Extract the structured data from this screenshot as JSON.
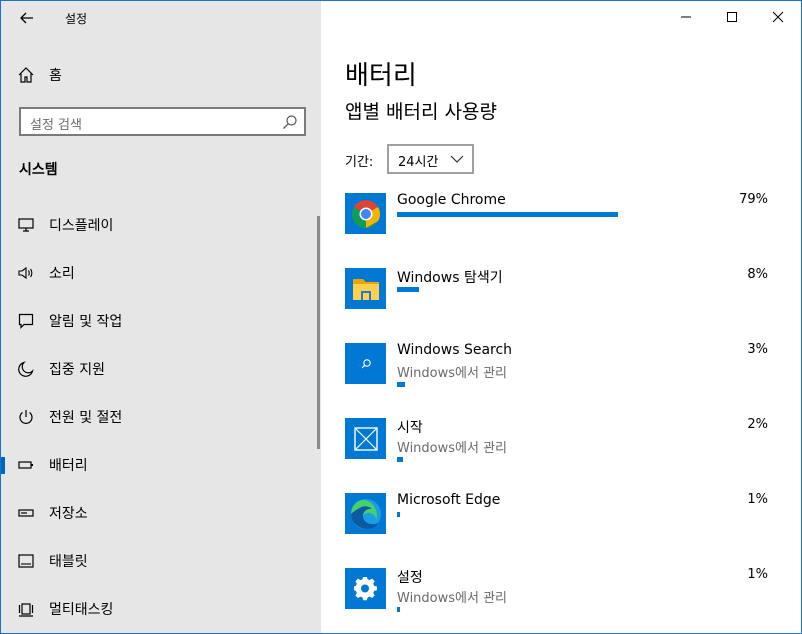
{
  "window": {
    "title": "설정",
    "controls": [
      "minimize-icon",
      "maximize-icon",
      "close-icon"
    ]
  },
  "sidebar": {
    "home_label": "홈",
    "search_placeholder": "설정 검색",
    "section_title": "시스템",
    "items": [
      {
        "label": "디스플레이",
        "icon": "monitor-icon",
        "selected": false
      },
      {
        "label": "소리",
        "icon": "speaker-icon",
        "selected": false
      },
      {
        "label": "알림 및 작업",
        "icon": "notification-icon",
        "selected": false
      },
      {
        "label": "집중 지원",
        "icon": "moon-icon",
        "selected": false
      },
      {
        "label": "전원 및 절전",
        "icon": "power-icon",
        "selected": false
      },
      {
        "label": "배터리",
        "icon": "battery-icon",
        "selected": true
      },
      {
        "label": "저장소",
        "icon": "storage-icon",
        "selected": false
      },
      {
        "label": "태블릿",
        "icon": "tablet-icon",
        "selected": false
      },
      {
        "label": "멀티태스킹",
        "icon": "multitasking-icon",
        "selected": false
      }
    ]
  },
  "main": {
    "title": "배터리",
    "subtitle": "앱별 배터리 사용량",
    "period_label": "기간:",
    "period_value": "24시간",
    "apps": [
      {
        "name": "Google Chrome",
        "manage": "",
        "percent_text": "79%",
        "usage": 0.79,
        "icon": "chrome-icon"
      },
      {
        "name": "Windows 탐색기",
        "manage": "",
        "percent_text": "8%",
        "usage": 0.08,
        "icon": "folder-icon"
      },
      {
        "name": "Windows Search",
        "manage": "Windows에서 관리",
        "percent_text": "3%",
        "usage": 0.03,
        "icon": "search-app-icon"
      },
      {
        "name": "시작",
        "manage": "Windows에서 관리",
        "percent_text": "2%",
        "usage": 0.02,
        "icon": "start-icon"
      },
      {
        "name": "Microsoft Edge",
        "manage": "",
        "percent_text": "1%",
        "usage": 0.01,
        "icon": "edge-icon"
      },
      {
        "name": "설정",
        "manage": "Windows에서 관리",
        "percent_text": "1%",
        "usage": 0.01,
        "icon": "settings-gear-icon"
      }
    ]
  },
  "colors": {
    "accent": "#0078d4",
    "sidebar_bg": "#e6e6e6",
    "content_bg": "#ffffff"
  }
}
